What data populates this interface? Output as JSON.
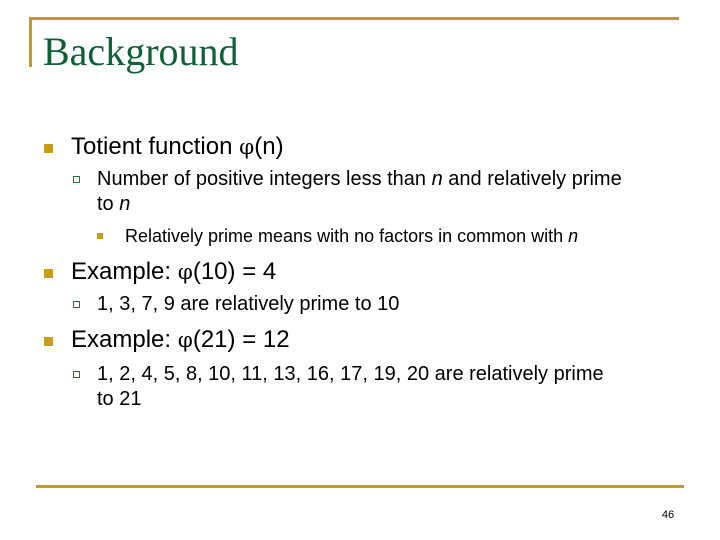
{
  "slide": {
    "title": "Background",
    "page_number": "46",
    "accent_color": "#c09a2c",
    "title_color": "#0e6036"
  },
  "bullets": {
    "totient": {
      "prefix": "Totient function ",
      "symbol": "φ",
      "suffix": "(n)",
      "sub": {
        "line1_a": "Number of positive integers less than ",
        "line1_n": "n",
        "line1_b": " and relatively prime",
        "line2_a": "to ",
        "line2_n": "n",
        "subsub": {
          "text": "Relatively prime means with no factors in common with ",
          "n": "n"
        }
      }
    },
    "example1": {
      "prefix": "Example: ",
      "symbol": "φ",
      "suffix": "(10) = 4",
      "sub": {
        "text": "1, 3, 7, 9 are relatively prime to 10"
      }
    },
    "example2": {
      "prefix": "Example: ",
      "symbol": "φ",
      "suffix": "(21) = 12",
      "sub": {
        "line1": "1, 2, 4, 5, 8, 10, 11, 13, 16, 17, 19, 20 are relatively prime",
        "line2": "to 21"
      }
    }
  }
}
